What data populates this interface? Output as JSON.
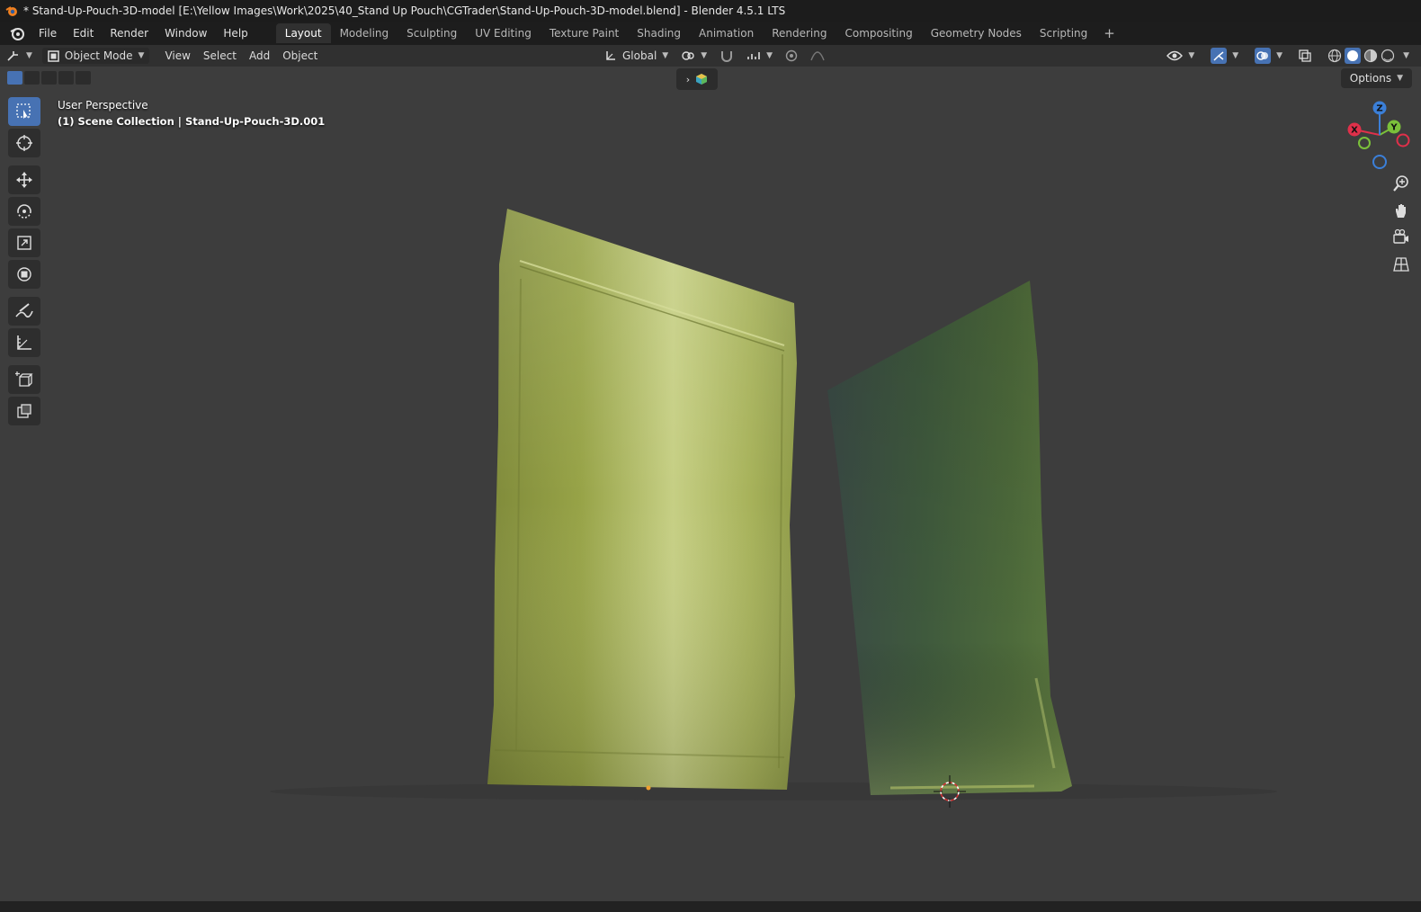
{
  "window": {
    "title": "* Stand-Up-Pouch-3D-model [E:\\Yellow Images\\Work\\2025\\40_Stand Up Pouch\\CGTrader\\Stand-Up-Pouch-3D-model.blend] - Blender 4.5.1 LTS"
  },
  "menu": {
    "items": [
      "File",
      "Edit",
      "Render",
      "Window",
      "Help"
    ]
  },
  "workspaces": {
    "tabs": [
      "Layout",
      "Modeling",
      "Sculpting",
      "UV Editing",
      "Texture Paint",
      "Shading",
      "Animation",
      "Rendering",
      "Compositing",
      "Geometry Nodes",
      "Scripting"
    ],
    "active": "Layout",
    "add_label": "+"
  },
  "header": {
    "mode": "Object Mode",
    "menus": [
      "View",
      "Select",
      "Add",
      "Object"
    ],
    "transform_orientation": "Global"
  },
  "viewport": {
    "perspective_label": "User Perspective",
    "collection_label": "(1) Scene Collection | Stand-Up-Pouch-3D.001",
    "options_label": "Options",
    "gizmo_axes": [
      "X",
      "Y",
      "Z"
    ]
  },
  "colors": {
    "accent": "#4772b3",
    "pouch_light": "#b9c46a",
    "pouch_dark": "#3f5a3a",
    "axis_x": "#e0304a",
    "axis_y": "#7bc13a",
    "axis_z": "#3b7fd8"
  },
  "icons": {
    "toolbar": [
      "select-box-icon",
      "cursor-icon",
      "move-icon",
      "rotate-icon",
      "scale-icon",
      "transform-icon",
      "annotate-icon",
      "measure-icon",
      "add-cube-icon",
      "add-primitive-icon"
    ],
    "nav": [
      "zoom-icon",
      "pan-hand-icon",
      "camera-icon",
      "grid-toggle-icon"
    ]
  }
}
